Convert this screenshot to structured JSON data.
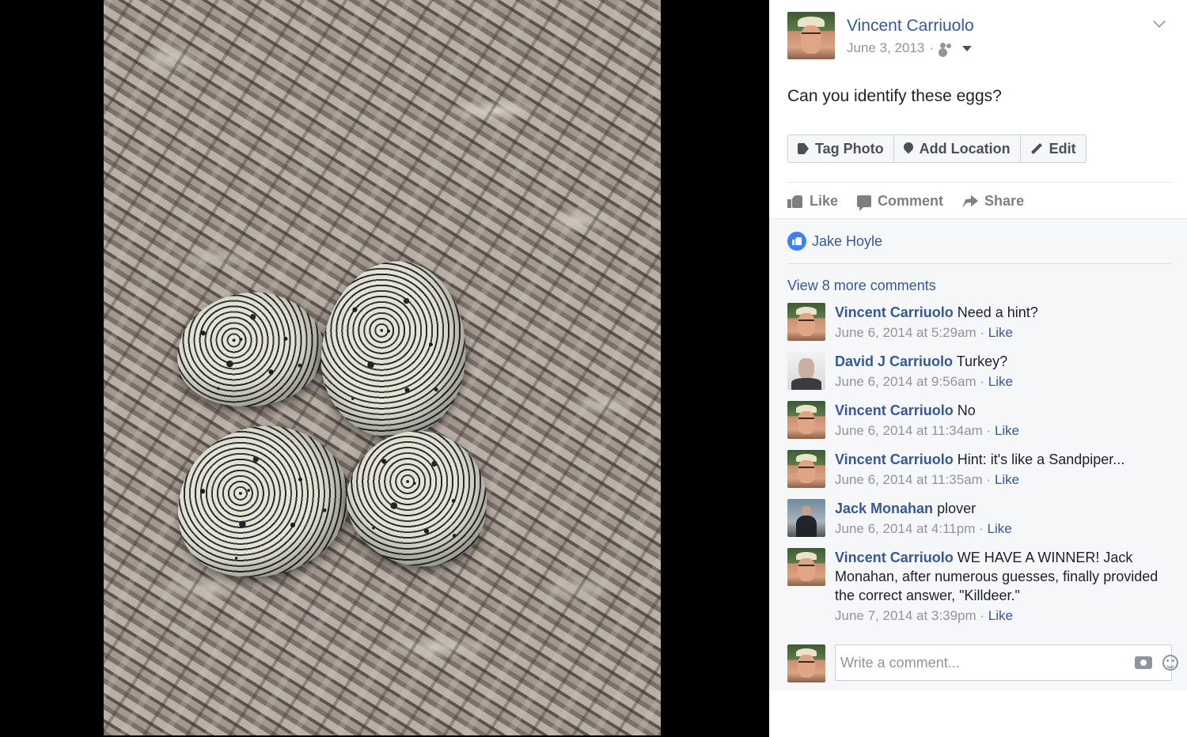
{
  "post": {
    "author": "Vincent Carriuolo",
    "date": "June 3, 2013",
    "date_separator": "·",
    "audience_icon": "friends-icon",
    "text": "Can you identify these eggs?"
  },
  "photo": {
    "subject": "Four speckled killdeer eggs on wood-chip mulch"
  },
  "photo_actions": {
    "tag_label": "Tag Photo",
    "location_label": "Add Location",
    "edit_label": "Edit"
  },
  "reactions": {
    "like_label": "Like",
    "comment_label": "Comment",
    "share_label": "Share"
  },
  "likes": {
    "liker": "Jake Hoyle"
  },
  "comments": {
    "view_more": "View 8 more comments",
    "items": [
      {
        "name": "Vincent Carriuolo",
        "text": "Need a hint?",
        "time": "June 6, 2014 at 5:29am",
        "sep": " · ",
        "like": "Like"
      },
      {
        "name": "David J Carriuolo",
        "text": "Turkey?",
        "time": "June 6, 2014 at 9:56am",
        "sep": " · ",
        "like": "Like"
      },
      {
        "name": "Vincent Carriuolo",
        "text": "No",
        "time": "June 6, 2014 at 11:34am",
        "sep": " · ",
        "like": "Like"
      },
      {
        "name": "Vincent Carriuolo",
        "text": "Hint: it's like a Sandpiper...",
        "time": "June 6, 2014 at 11:35am",
        "sep": " · ",
        "like": "Like"
      },
      {
        "name": "Jack Monahan",
        "text": "plover",
        "time": "June 6, 2014 at 4:11pm",
        "sep": " · ",
        "like": "Like"
      },
      {
        "name": "Vincent Carriuolo",
        "text": "WE HAVE A WINNER! Jack Monahan, after numerous guesses, finally provided the correct answer, \"Killdeer.\"",
        "time": "June 7, 2014 at 3:39pm",
        "sep": " · ",
        "like": "Like"
      }
    ]
  },
  "composer": {
    "placeholder": "Write a comment..."
  },
  "colors": {
    "link": "#365899",
    "like_badge": "#4080ff",
    "panel_bg": "#ffffff",
    "comments_bg": "#f6f7f9"
  }
}
